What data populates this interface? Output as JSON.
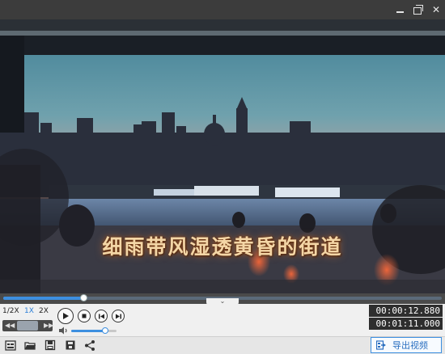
{
  "window": {
    "minimize_icon": "minimize-icon",
    "restore_icon": "restore-icon",
    "close_icon": "close-icon",
    "close_glyph": "✕"
  },
  "video": {
    "subtitle": "细雨带风湿透黄昏的街道"
  },
  "playback": {
    "progress": 0.183,
    "collapse_glyph": "⌄"
  },
  "speed": {
    "options": [
      "1/2X",
      "1X",
      "2X"
    ],
    "selected": "1X",
    "rewind_glyph": "◀◀",
    "forward_glyph": "▶▶"
  },
  "volume": {
    "level": 0.75
  },
  "time": {
    "current": "00:00:12.880",
    "total": "00:01:11.000"
  },
  "toolbar": {
    "export_label": "导出视频",
    "icons": [
      "subtitle-edit-icon",
      "open-folder-icon",
      "save-icon",
      "save-as-icon",
      "share-icon"
    ]
  },
  "colors": {
    "accent": "#3d8fe0",
    "subtitle_text": "#f4d6a6"
  }
}
